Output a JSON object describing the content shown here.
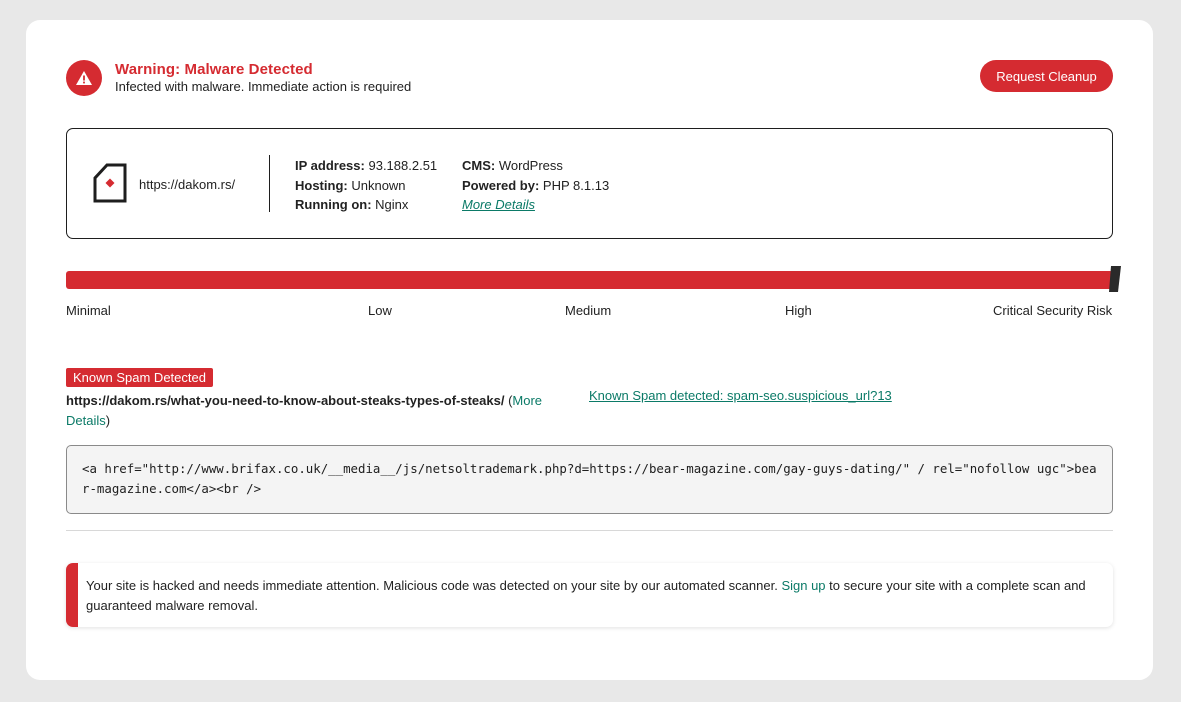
{
  "header": {
    "title": "Warning: Malware Detected",
    "subtitle": "Infected with malware. Immediate action is required",
    "cleanup_button": "Request Cleanup",
    "icon": "warning-triangle-icon"
  },
  "site": {
    "url": "https://dakom.rs/",
    "icon": "site-document-icon",
    "ip_label": "IP address:",
    "ip_value": "93.188.2.51",
    "hosting_label": "Hosting:",
    "hosting_value": "Unknown",
    "running_label": "Running on:",
    "running_value": "Nginx",
    "cms_label": "CMS:",
    "cms_value": "WordPress",
    "powered_label": "Powered by:",
    "powered_value": "PHP 8.1.13",
    "more_details": "More Details"
  },
  "risk": {
    "level_fraction": 1.0,
    "labels": [
      "Minimal",
      "Low",
      "Medium",
      "High",
      "Critical Security Risk"
    ]
  },
  "spam": {
    "badge": "Known Spam Detected",
    "url": "https://dakom.rs/what-you-need-to-know-about-steaks-types-of-steaks/",
    "open_paren": " (",
    "more_details": "More Details",
    "close_paren": ")",
    "signature": "Known Spam detected: spam-seo.suspicious_url?13",
    "code": "<a href=\"http://www.brifax.co.uk/__media__/js/netsoltrademark.php?d=https://bear-magazine.com/gay-guys-dating/\" / rel=\"nofollow ugc\">bear-magazine.com</a><br />"
  },
  "notice": {
    "text_before": "Your site is hacked and needs immediate attention. Malicious code was detected on your site by our automated scanner. ",
    "signup_link": "Sign up",
    "text_after": " to secure your site with a complete scan and guaranteed malware removal."
  },
  "colors": {
    "accent_red": "#d52b31",
    "link_green": "#0b7a67"
  }
}
